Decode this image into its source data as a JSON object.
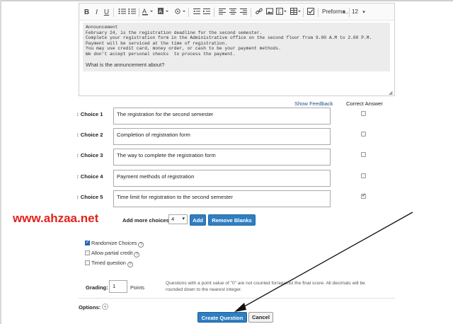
{
  "toolbar": {
    "bold_label": "B",
    "italic_label": "I",
    "underline_label": "U",
    "format_select": "Preforma...",
    "size_select": "12"
  },
  "content": {
    "lines": [
      "Announcement",
      "February 24, is the registration deadline for the second semester.",
      "Complete your registration form in the Administrative office on the second floor from 9.00 A.M to 2.00 P.M.",
      "Payment will be serviced at the time of registration.",
      "You may use credit card, money order, or cash to be your payment methods.",
      "We don't accept personal checks  to process the payment."
    ],
    "question": "What is the annuncement about?"
  },
  "header": {
    "show_feedback": "Show Feedback",
    "correct_answer": "Correct Answer"
  },
  "choices": [
    {
      "label": "Choice 1",
      "text": "The registration for the second semester",
      "correct": false
    },
    {
      "label": "Choice 2",
      "text": "Completion of registration form",
      "correct": false
    },
    {
      "label": "Choice 3",
      "text": "The way to complete the registration  form",
      "correct": false
    },
    {
      "label": "Choice 4",
      "text": "Payment methods of registration",
      "correct": false
    },
    {
      "label": "Choice 5",
      "text": "Time limit for registration to the second semester",
      "correct": true
    }
  ],
  "add_more": {
    "label": "Add more choices:",
    "value": "4",
    "add_button": "Add",
    "remove_blanks_button": "Remove Blanks"
  },
  "watermark": "www.ahzaa.net",
  "options": {
    "randomize": "Randomize Choices",
    "partial_credit": "Allow partial credit",
    "timed": "Timed question"
  },
  "grading": {
    "label": "Grading:",
    "value": "1",
    "points_label": "Points",
    "note": "Questions with a point value of \"0\" are not counted for/against the final score. All decimals will be rounded down to the nearest integer."
  },
  "footer": {
    "options_label": "Options:",
    "create_button": "Create Question",
    "cancel_button": "Cancel"
  },
  "colors": {
    "accent": "#2f7ec1",
    "watermark": "#e3221c",
    "link": "#1e4d8c"
  }
}
